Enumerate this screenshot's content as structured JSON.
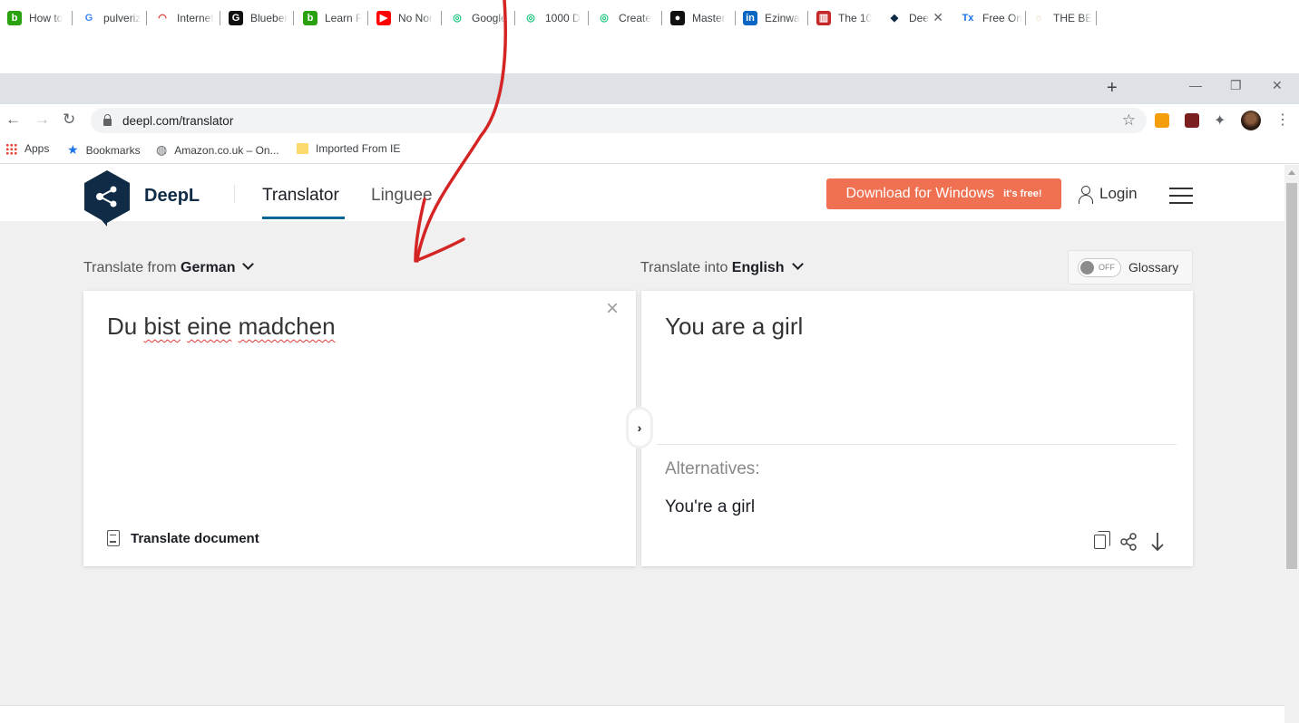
{
  "browser": {
    "tabs": [
      {
        "title": "How to",
        "favicon": "bing-b-icon",
        "color": "#2aa10f",
        "glyph": "b"
      },
      {
        "title": "pulveriz",
        "favicon": "google-g-icon",
        "color": "#4285f4",
        "glyph": "G"
      },
      {
        "title": "Internet",
        "favicon": "speedometer-icon",
        "color": "#d93025",
        "glyph": "◠"
      },
      {
        "title": "Blueber",
        "favicon": "grammarly-icon",
        "color": "#111111",
        "glyph": "G"
      },
      {
        "title": "Learn F",
        "favicon": "bing-b-icon",
        "color": "#2aa10f",
        "glyph": "b"
      },
      {
        "title": "No Nor",
        "favicon": "youtube-icon",
        "color": "#ff0000",
        "glyph": "▶"
      },
      {
        "title": "Google",
        "favicon": "chatgpt-icon",
        "color": "#19c37d",
        "glyph": "◎"
      },
      {
        "title": "1000 D",
        "favicon": "chatgpt-icon",
        "color": "#19c37d",
        "glyph": "◎"
      },
      {
        "title": "Create",
        "favicon": "chatgpt-icon",
        "color": "#19c37d",
        "glyph": "◎"
      },
      {
        "title": "Master",
        "favicon": "github-icon",
        "color": "#111111",
        "glyph": "●"
      },
      {
        "title": "Ezinwa",
        "favicon": "linkedin-icon",
        "color": "#0a66c2",
        "glyph": "in"
      },
      {
        "title": "The 10",
        "favicon": "document-icon",
        "color": "#c62828",
        "glyph": "▥"
      },
      {
        "title": "Dee",
        "favicon": "deepl-icon",
        "color": "#0f2b46",
        "glyph": "◆",
        "active": true
      },
      {
        "title": "Free On",
        "favicon": "clear-format-icon",
        "color": "#1a73e8",
        "glyph": "Tx"
      },
      {
        "title": "THE BE",
        "favicon": "loading-spinner-icon",
        "color": "#e8d9b0",
        "glyph": "☼"
      }
    ],
    "new_tab": "+",
    "window_controls": {
      "minimize": "—",
      "restore": "❐",
      "close": "✕"
    },
    "url": "deepl.com/translator",
    "bookmarks": [
      {
        "label": "Apps",
        "icon": "apps-grid-icon"
      },
      {
        "label": "Bookmarks",
        "icon": "star-icon"
      },
      {
        "label": "Amazon.co.uk – On...",
        "icon": "globe-icon"
      },
      {
        "label": "Imported From IE",
        "icon": "folder-icon"
      }
    ]
  },
  "deepl": {
    "brand": "DeepL",
    "nav": {
      "translator": "Translator",
      "linguee": "Linguee"
    },
    "download": {
      "label": "Download for Windows",
      "free": "it's free!"
    },
    "login": "Login",
    "source": {
      "prefix": "Translate from",
      "language": "German",
      "words": [
        "Du",
        "bist",
        "eine",
        "madchen"
      ],
      "misspelled": [
        false,
        true,
        true,
        true
      ]
    },
    "target": {
      "prefix": "Translate into",
      "language": "English",
      "text": "You are a girl"
    },
    "glossary": {
      "toggle": "OFF",
      "label": "Glossary"
    },
    "translate_document": "Translate document",
    "alternatives_label": "Alternatives:",
    "alternatives": [
      "You're a girl"
    ]
  },
  "colors": {
    "accent": "#006494",
    "brand": "#0f2b46",
    "download": "#f07151",
    "annotation": "#d42424"
  }
}
